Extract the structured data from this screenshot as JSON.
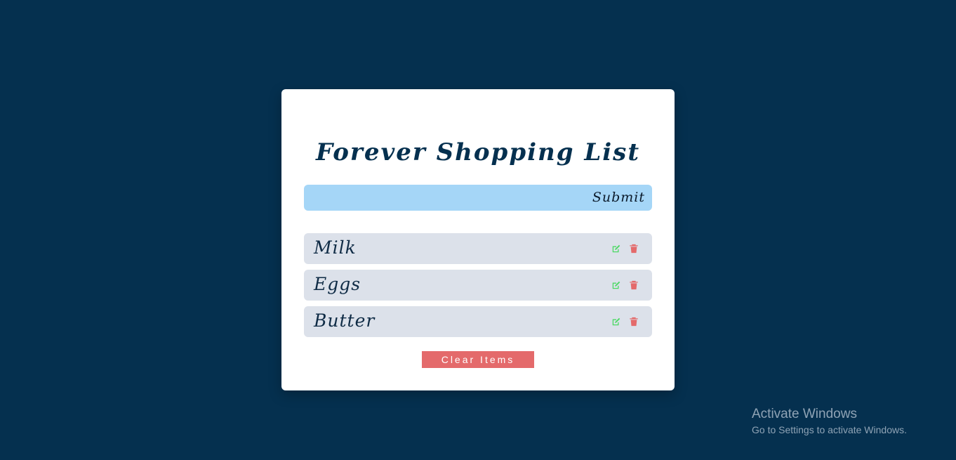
{
  "app": {
    "title": "Forever Shopping List"
  },
  "form": {
    "input_value": "",
    "input_placeholder": "",
    "submit_label": "Submit"
  },
  "items": [
    {
      "name": "Milk",
      "edit_icon": "edit-icon",
      "delete_icon": "trash-icon"
    },
    {
      "name": "Eggs",
      "edit_icon": "edit-icon",
      "delete_icon": "trash-icon"
    },
    {
      "name": "Butter",
      "edit_icon": "edit-icon",
      "delete_icon": "trash-icon"
    }
  ],
  "clear_button": {
    "label": "Clear Items"
  },
  "watermark": {
    "title": "Activate Windows",
    "subtitle": "Go to Settings to activate Windows."
  },
  "colors": {
    "background": "#05304f",
    "card": "#ffffff",
    "input_bg": "#a5d6f7",
    "item_bg": "#dce1ea",
    "edit_icon": "#4cd964",
    "delete_icon": "#e46a6b",
    "clear_button": "#e46a6b"
  }
}
